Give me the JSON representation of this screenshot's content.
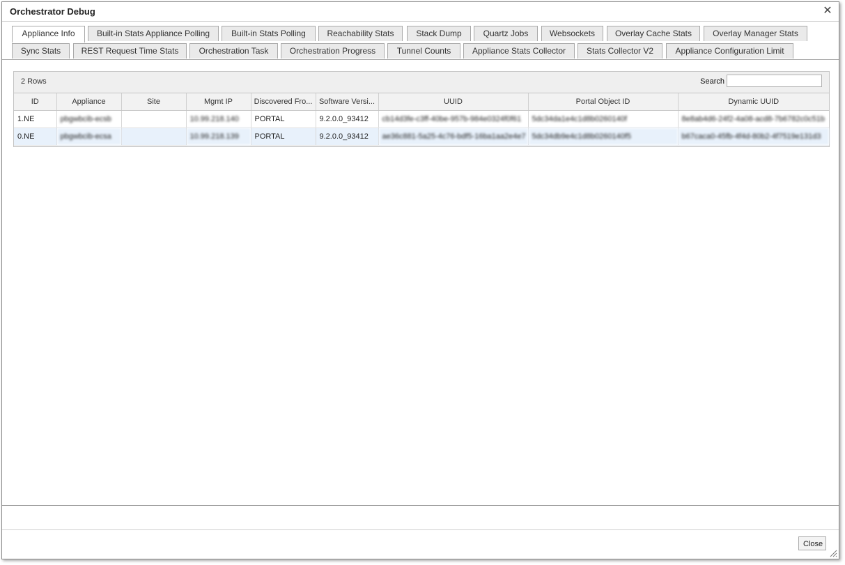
{
  "window": {
    "title": "Orchestrator Debug"
  },
  "tabs": {
    "row1": [
      {
        "label": "Appliance Info",
        "active": true
      },
      {
        "label": "Built-in Stats Appliance Polling"
      },
      {
        "label": "Built-in Stats Polling"
      },
      {
        "label": "Reachability Stats"
      },
      {
        "label": "Stack Dump"
      },
      {
        "label": "Quartz Jobs"
      },
      {
        "label": "Websockets"
      },
      {
        "label": "Overlay Cache Stats"
      },
      {
        "label": "Overlay Manager Stats"
      }
    ],
    "row2": [
      {
        "label": "Sync Stats"
      },
      {
        "label": "REST Request Time Stats"
      },
      {
        "label": "Orchestration Task"
      },
      {
        "label": "Orchestration Progress"
      },
      {
        "label": "Tunnel Counts"
      },
      {
        "label": "Appliance Stats Collector"
      },
      {
        "label": "Stats Collector V2"
      },
      {
        "label": "Appliance Configuration Limit"
      }
    ]
  },
  "grid": {
    "row_count": "2 Rows",
    "search_label": "Search",
    "search_value": "",
    "columns": [
      "ID",
      "Appliance",
      "Site",
      "Mgmt IP",
      "Discovered Fro...",
      "Software Versi...",
      "UUID",
      "Portal Object ID",
      "Dynamic UUID"
    ],
    "rows": [
      {
        "id": "1.NE",
        "appliance": "pbgwbcib-ecsb",
        "site": "",
        "mgmt_ip": "10.99.218.140",
        "discovered": "PORTAL",
        "version": "9.2.0.0_93412",
        "uuid": "cb14d3fe-c3ff-40be-957b-984e0324f0f61",
        "portal_id": "5dc34da1e4c1d8b0260140f",
        "dynamic_uuid": "8e8ab4d6-24f2-4a08-acd8-7b6782c0c51b"
      },
      {
        "id": "0.NE",
        "appliance": "pbgwbcib-ecsa",
        "site": "",
        "mgmt_ip": "10.99.218.139",
        "discovered": "PORTAL",
        "version": "9.2.0.0_93412",
        "uuid": "ae36c881-5a25-4c76-bdf5-16ba1aa2e4e7",
        "portal_id": "5dc34db9e4c1d8b0260140f5",
        "dynamic_uuid": "b67caca0-45fb-4f4d-80b2-4f7519e131d3"
      }
    ]
  },
  "footer": {
    "close_label": "Close"
  }
}
